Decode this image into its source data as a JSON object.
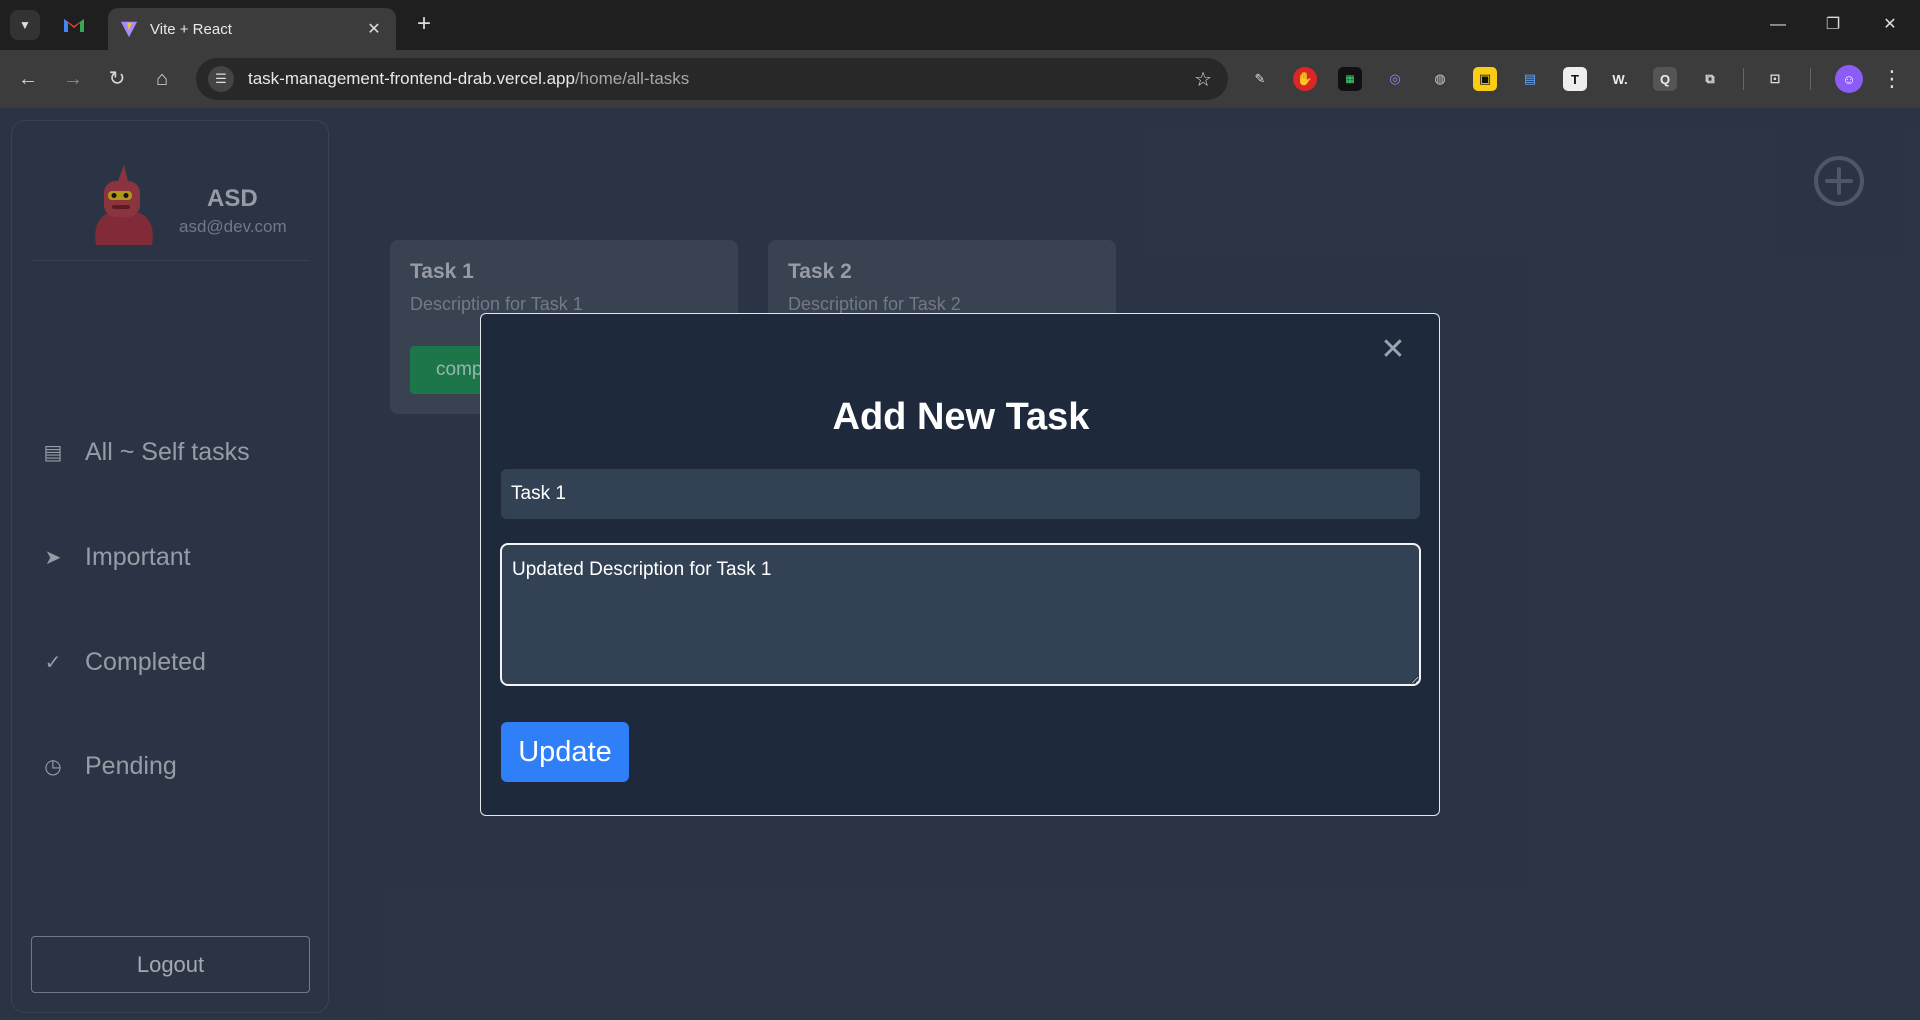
{
  "browser": {
    "tab_title": "Vite + React",
    "url_host": "task-management-frontend-drab.vercel.app",
    "url_path": "/home/all-tasks"
  },
  "user": {
    "name": "ASD",
    "email": "asd@dev.com"
  },
  "sidebar": {
    "items": [
      {
        "label": "All ~ Self tasks",
        "icon": "document-list-icon"
      },
      {
        "label": "Important",
        "icon": "label-tag-icon"
      },
      {
        "label": "Completed",
        "icon": "double-check-icon"
      },
      {
        "label": "Pending",
        "icon": "clipboard-clock-icon"
      }
    ],
    "logout_label": "Logout"
  },
  "tasks": [
    {
      "title": "Task 1",
      "description": "Description for Task 1",
      "status_label": "completed"
    },
    {
      "title": "Task 2",
      "description": "Description for Task 2"
    }
  ],
  "modal": {
    "title": "Add New Task",
    "title_value": "Task 1",
    "description_value": "Updated Description for Task 1",
    "submit_label": "Update"
  },
  "colors": {
    "background": "#374151",
    "modal_background": "#1e293b",
    "accent_blue": "#2f7ff8",
    "status_green": "#22a05a"
  }
}
